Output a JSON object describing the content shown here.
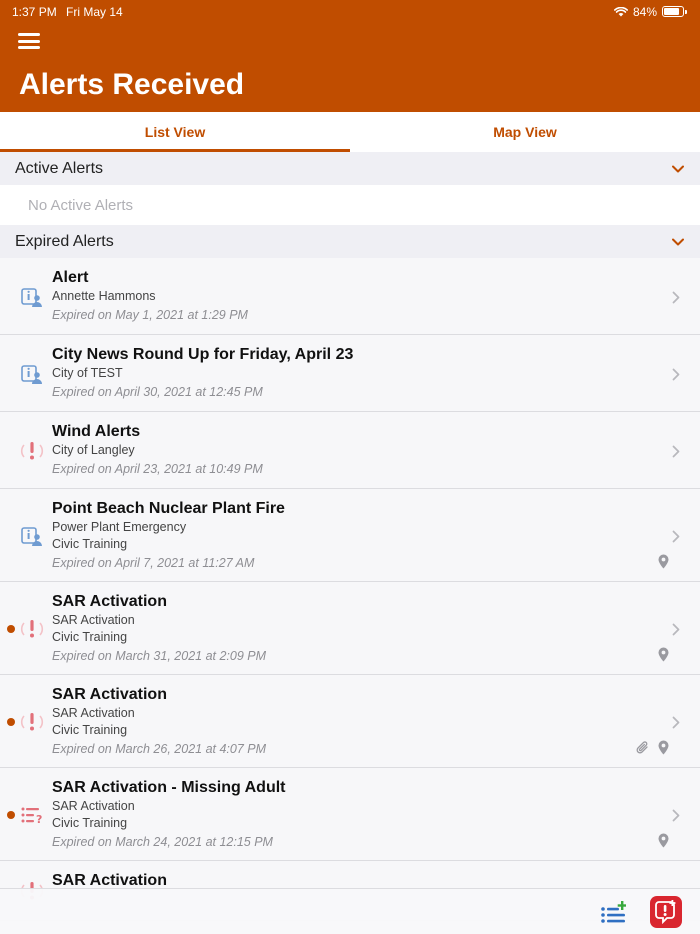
{
  "status": {
    "time": "1:37 PM",
    "date": "Fri May 14",
    "battery": "84%",
    "battery_level": 0.84
  },
  "header": {
    "title": "Alerts Received"
  },
  "tabs": [
    {
      "label": "List View",
      "active": true
    },
    {
      "label": "Map View",
      "active": false
    }
  ],
  "active_section": {
    "label": "Active Alerts",
    "empty_text": "No Active Alerts"
  },
  "expired_section": {
    "label": "Expired Alerts"
  },
  "colors": {
    "accent": "#c04d00",
    "info_icon": "#6f9bd1",
    "alert_icon": "#e2707a",
    "unread_dot": "#c04d00"
  },
  "items": [
    {
      "title": "Alert",
      "lines": [
        "Annette Hammons"
      ],
      "expired": "Expired on May 1, 2021 at 1:29 PM",
      "icon": "info-person-icon",
      "unread": false,
      "attachment": false,
      "location": false
    },
    {
      "title": "City News Round Up for Friday, April 23",
      "lines": [
        "City of TEST"
      ],
      "expired": "Expired on April 30, 2021 at 12:45 PM",
      "icon": "info-person-icon",
      "unread": false,
      "attachment": false,
      "location": false
    },
    {
      "title": "Wind Alerts",
      "lines": [
        "City of Langley"
      ],
      "expired": "Expired on April 23, 2021 at 10:49 PM",
      "icon": "exclamation-icon",
      "unread": false,
      "attachment": false,
      "location": false
    },
    {
      "title": "Point Beach Nuclear Plant Fire",
      "lines": [
        "Power Plant Emergency",
        "Civic Training"
      ],
      "expired": "Expired on April 7, 2021 at 11:27 AM",
      "icon": "info-person-icon",
      "unread": false,
      "attachment": false,
      "location": true
    },
    {
      "title": "SAR Activation",
      "lines": [
        "SAR Activation",
        "Civic Training"
      ],
      "expired": "Expired on March 31, 2021 at 2:09 PM",
      "icon": "exclamation-icon",
      "unread": true,
      "attachment": false,
      "location": true
    },
    {
      "title": "SAR Activation",
      "lines": [
        "SAR Activation",
        "Civic Training"
      ],
      "expired": "Expired on March 26, 2021 at 4:07 PM",
      "icon": "exclamation-icon",
      "unread": true,
      "attachment": true,
      "location": true
    },
    {
      "title": "SAR Activation - Missing Adult",
      "lines": [
        "SAR Activation",
        "Civic Training"
      ],
      "expired": "Expired on March 24, 2021 at 12:15 PM",
      "icon": "question-list-icon",
      "unread": true,
      "attachment": false,
      "location": true
    },
    {
      "title": "SAR Activation",
      "lines": [],
      "expired": "",
      "icon": "exclamation-icon",
      "unread": false,
      "attachment": false,
      "location": false
    }
  ]
}
